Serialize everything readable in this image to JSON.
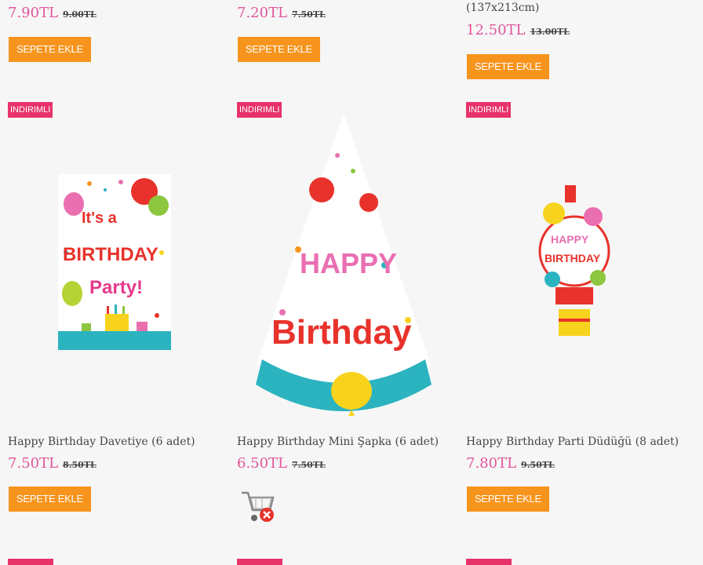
{
  "colors": {
    "price": "#e0569b",
    "button": "#f7941d",
    "badge": "#e7336a"
  },
  "top_row": [
    {
      "price": "7.90TL",
      "old_price": "9.00TL",
      "button": "SEPETE EKLE"
    },
    {
      "price": "7.20TL",
      "old_price": "7.50TL",
      "button": "SEPETE EKLE"
    },
    {
      "size_text": "(137x213cm)",
      "price": "12.50TL",
      "old_price": "13.00TL",
      "button": "SEPETE EKLE"
    }
  ],
  "products": [
    {
      "badge": "INDIRIMLI",
      "name": "Happy Birthday Davetiye (6 adet)",
      "price": "7.50TL",
      "old_price": "8.50TL",
      "button": "SEPETE EKLE",
      "image_text": [
        "It's a",
        "BIRTHDAY",
        "Party!"
      ]
    },
    {
      "badge": "INDIRIMLI",
      "name": "Happy Birthday Mini Şapka (6 adet)",
      "price": "6.50TL",
      "old_price": "7.50TL",
      "icon": "cart-remove-icon",
      "image_text": [
        "HAPPY",
        "Birthday"
      ]
    },
    {
      "badge": "INDIRIMLI",
      "name": "Happy Birthday Parti Düdüğü (8 adet)",
      "price": "7.80TL",
      "old_price": "9.50TL",
      "button": "SEPETE EKLE",
      "image_text": [
        "HAPPY",
        "BIRTHDAY"
      ]
    }
  ]
}
